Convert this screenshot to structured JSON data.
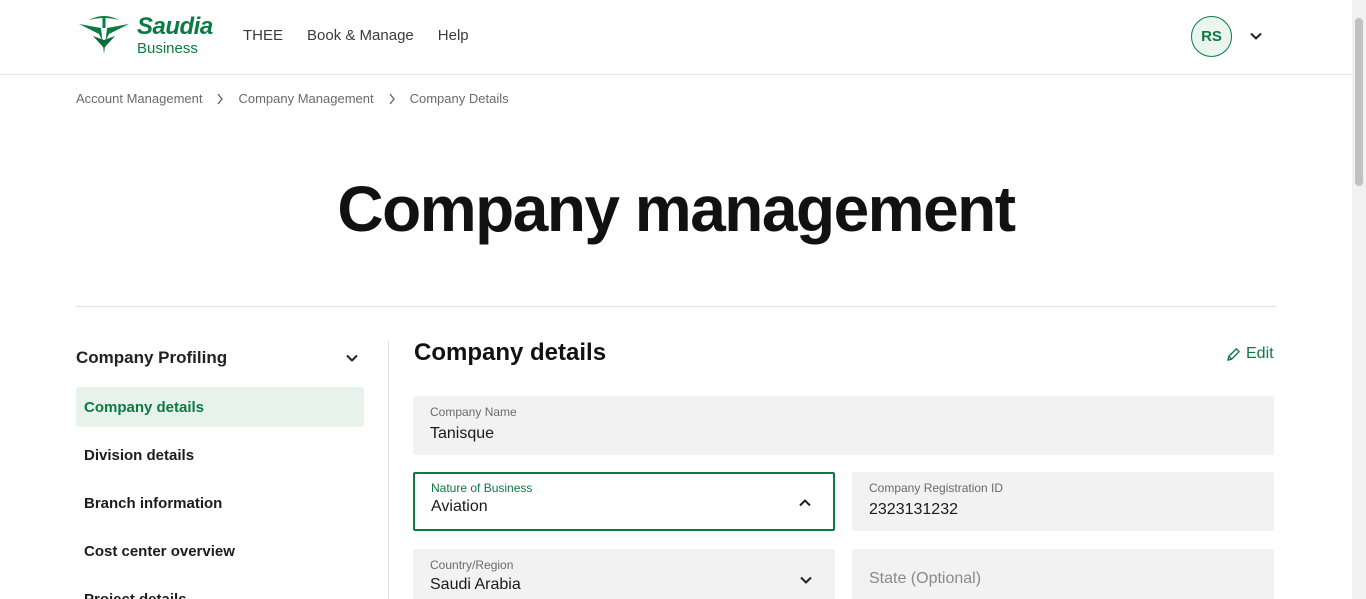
{
  "brand": {
    "name": "Saudia",
    "sub": "Business",
    "color": "#0c7a43"
  },
  "nav": {
    "items": [
      "THEE",
      "Book & Manage",
      "Help"
    ]
  },
  "user": {
    "initials": "RS"
  },
  "breadcrumb": [
    "Account Management",
    "Company Management",
    "Company Details"
  ],
  "page": {
    "title": "Company management"
  },
  "sidebar": {
    "heading": "Company Profiling",
    "items": [
      "Company details",
      "Division details",
      "Branch information",
      "Cost center overview",
      "Project details"
    ]
  },
  "main": {
    "title": "Company details",
    "edit_label": "Edit",
    "fields": {
      "company_name": {
        "label": "Company Name",
        "value": "Tanisque"
      },
      "nature_of_business": {
        "label": "Nature of Business",
        "value": "Aviation"
      },
      "registration_id": {
        "label": "Company Registration ID",
        "value": "2323131232"
      },
      "country": {
        "label": "Country/Region",
        "value": "Saudi Arabia"
      },
      "state": {
        "placeholder": "State (Optional)"
      }
    }
  }
}
